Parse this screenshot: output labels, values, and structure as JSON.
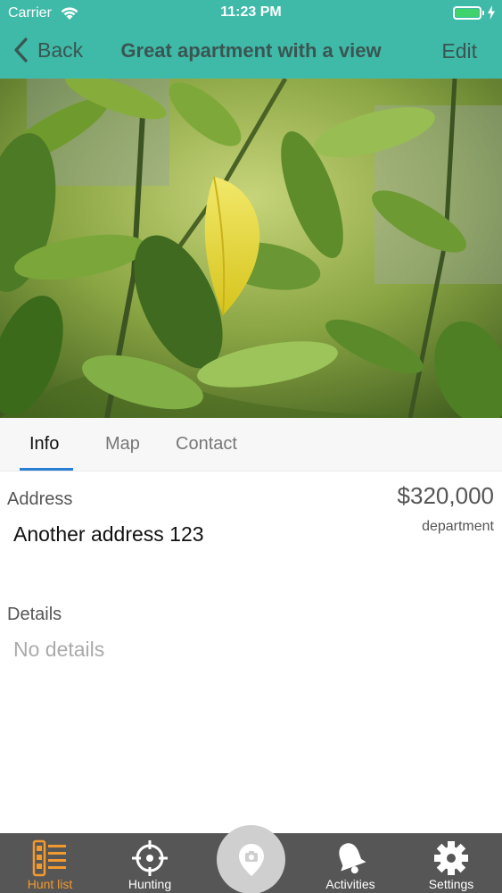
{
  "status_bar": {
    "carrier": "Carrier",
    "time": "11:23 PM",
    "battery_color": "#41d36b"
  },
  "nav": {
    "back_label": "Back",
    "title": "Great apartment with a view",
    "edit_label": "Edit",
    "bar_color": "#3fbaa8"
  },
  "hero": {
    "image": "photo-of-green-leaves-with-yellow-leaf"
  },
  "tabs": [
    {
      "label": "Info",
      "active": true
    },
    {
      "label": "Map",
      "active": false
    },
    {
      "label": "Contact",
      "active": false
    }
  ],
  "info": {
    "address_label": "Address",
    "address_value": "Another address 123",
    "price": "$320,000",
    "property_type": "department",
    "details_label": "Details",
    "details_value": "No details"
  },
  "tabbar": {
    "items": [
      {
        "label": "Hunt list",
        "icon": "hunt-list-icon",
        "active": true
      },
      {
        "label": "Hunting",
        "icon": "crosshair-icon",
        "active": false
      },
      {
        "label": "",
        "icon": "location-camera-icon",
        "active": false
      },
      {
        "label": "Activities",
        "icon": "bell-icon",
        "active": false
      },
      {
        "label": "Settings",
        "icon": "gear-icon",
        "active": false
      }
    ],
    "active_color": "#f39a2f"
  }
}
